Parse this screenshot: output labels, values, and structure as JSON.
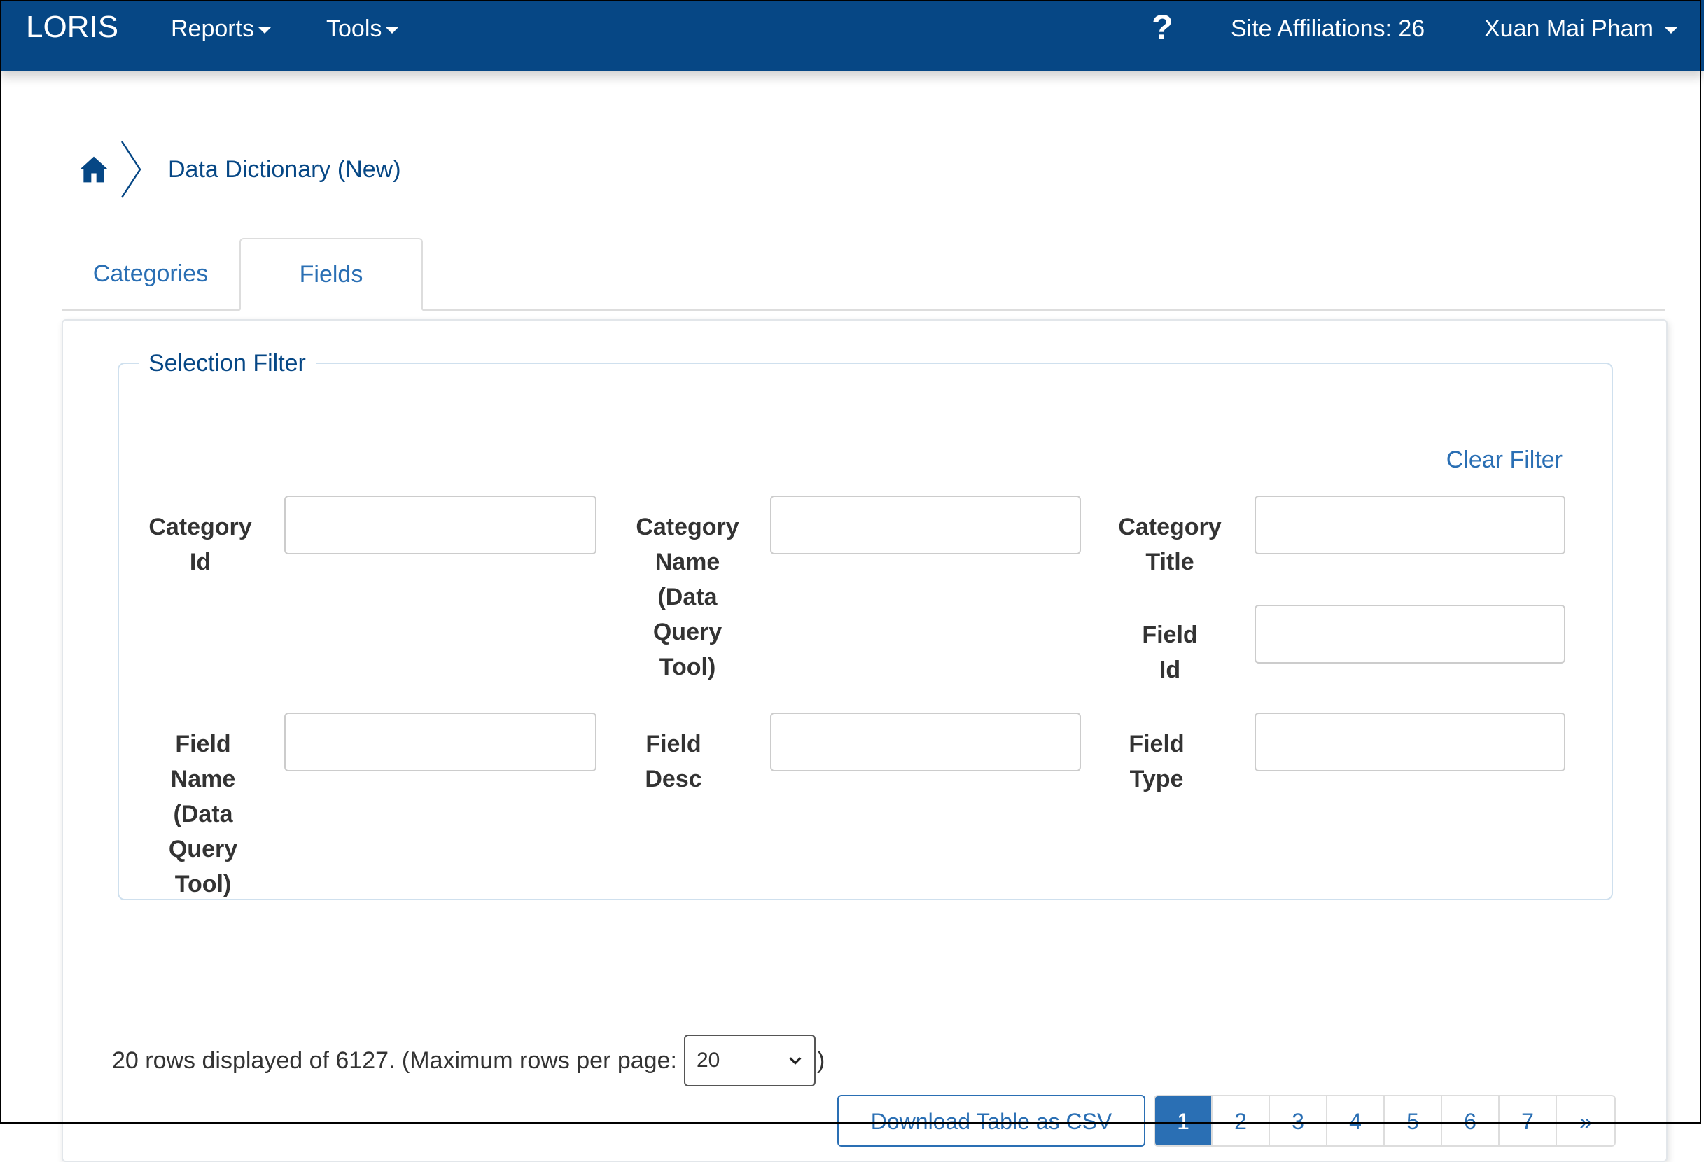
{
  "navbar": {
    "brand": "LORIS",
    "reports": "Reports",
    "tools": "Tools",
    "help_icon": "?",
    "site_affiliations": "Site Affiliations: 26",
    "user": "Xuan Mai Pham"
  },
  "breadcrumb": {
    "current": "Data Dictionary (New)"
  },
  "tabs": [
    {
      "label": "Categories"
    },
    {
      "label": "Fields"
    }
  ],
  "filter": {
    "legend": "Selection Filter",
    "clear": "Clear Filter",
    "fields": {
      "category_id": {
        "label_lines": [
          "Category",
          "Id"
        ],
        "value": ""
      },
      "category_name": {
        "label_lines": [
          "Category",
          "Name",
          "(Data",
          "Query",
          "Tool)"
        ],
        "value": ""
      },
      "category_title": {
        "label_lines": [
          "Category",
          "Title"
        ],
        "value": ""
      },
      "field_id": {
        "label_lines": [
          "Field",
          "Id"
        ],
        "value": ""
      },
      "field_name": {
        "label_lines": [
          "Field",
          "Name",
          "(Data",
          "Query",
          "Tool)"
        ],
        "value": ""
      },
      "field_desc": {
        "label_lines": [
          "Field",
          "Desc"
        ],
        "value": ""
      },
      "field_type": {
        "label_lines": [
          "Field",
          "Type"
        ],
        "value": ""
      }
    }
  },
  "table": {
    "rows_info": "20 rows displayed of 6127. (Maximum rows per page:",
    "rows_select": "20",
    "rows_close": ")",
    "download_csv": "Download Table as CSV",
    "pages": [
      "1",
      "2",
      "3",
      "4",
      "5",
      "6",
      "7",
      "»"
    ]
  }
}
